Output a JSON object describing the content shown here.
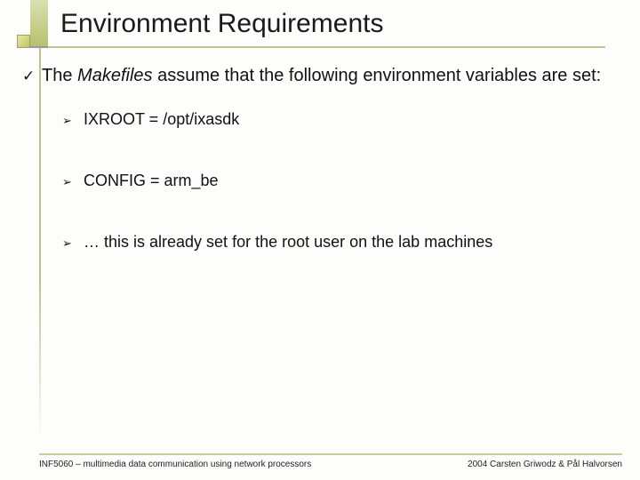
{
  "title": "Environment Requirements",
  "intro": {
    "pre": "The ",
    "italic": "Makefiles",
    "post": " assume that the following environment variables are set:"
  },
  "items": [
    "IXROOT = /opt/ixasdk",
    "CONFIG = arm_be",
    "… this is already set for the root user on the lab machines"
  ],
  "footer": {
    "left": "INF5060 – multimedia data communication using network processors",
    "right": "2004  Carsten Griwodz & Pål Halvorsen"
  }
}
